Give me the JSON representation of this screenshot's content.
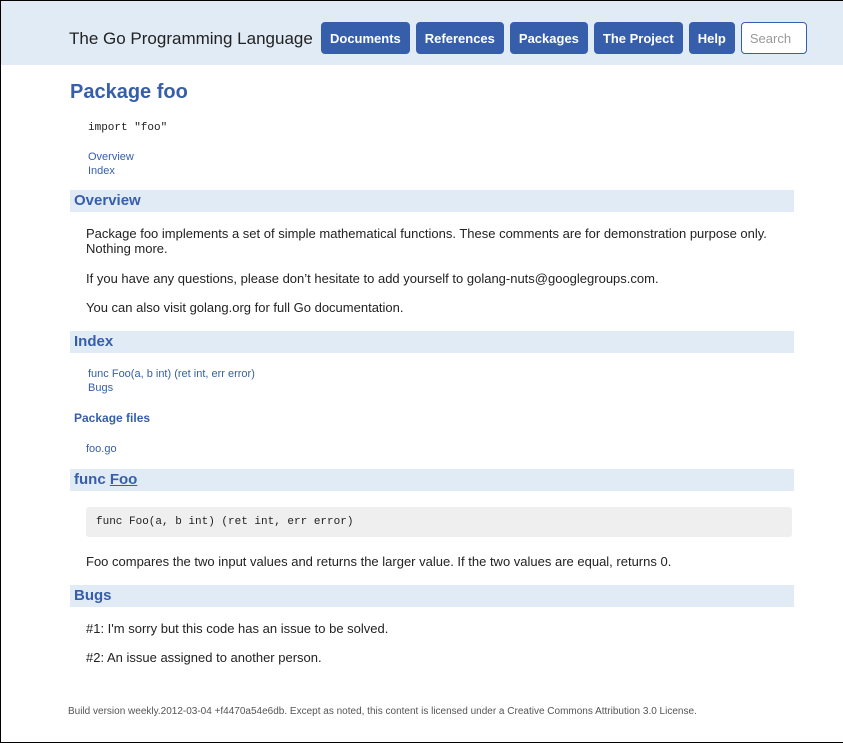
{
  "header": {
    "site_title": "The Go Programming Language",
    "nav": [
      "Documents",
      "References",
      "Packages",
      "The Project",
      "Help"
    ],
    "search_placeholder": "Search"
  },
  "page_title": "Package foo",
  "import_line": "import \"foo\"",
  "toc": [
    "Overview",
    "Index"
  ],
  "overview": {
    "heading": "Overview",
    "paragraphs": [
      "Package foo implements a set of simple mathematical functions. These comments are for demonstration purpose only. Nothing more.",
      "If you have any questions, please don’t hesitate to add yourself to golang-nuts@googlegroups.com.",
      "You can also visit golang.org for full Go documentation."
    ]
  },
  "index": {
    "heading": "Index",
    "items": [
      "func Foo(a, b int) (ret int, err error)",
      "Bugs"
    ],
    "files_heading": "Package files",
    "files": [
      "foo.go"
    ]
  },
  "func_foo": {
    "heading_prefix": "func",
    "heading_name": "Foo",
    "signature": "func Foo(a, b int) (ret int, err error)",
    "description": "Foo compares the two input values and returns the larger value. If the two values are equal, returns 0."
  },
  "bugs": {
    "heading": "Bugs",
    "items": [
      "#1: I'm sorry but this code has an issue to be solved.",
      "#2: An issue assigned to another person."
    ]
  },
  "footer": "Build version weekly.2012-03-04 +f4470a54e6db. Except as noted, this content is licensed under a Creative Commons Attribution 3.0 License.",
  "colors": {
    "accent": "#375eab",
    "band": "#e0ebf5",
    "code_bg": "#efefef"
  }
}
